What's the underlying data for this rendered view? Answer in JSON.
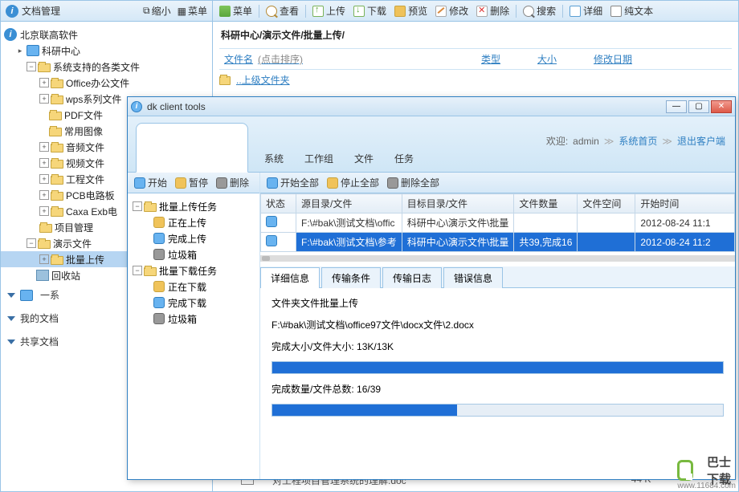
{
  "left": {
    "title": "文档管理",
    "btn_shrink": "缩小",
    "btn_menu": "菜单",
    "root": "北京联高软件",
    "nodes": {
      "n1": "科研中心",
      "n2": "系统支持的各类文件",
      "n3": "Office办公文件",
      "n4": "wps系列文件",
      "n5": "PDF文件",
      "n6": "常用图像",
      "n7": "音频文件",
      "n8": "视频文件",
      "n9": "工程文件",
      "n10": "PCB电路板",
      "n11": "Caxa Exb电",
      "n12": "项目管理",
      "n13": "演示文件",
      "n14": "批量上传",
      "n15": "回收站"
    },
    "sections": {
      "s1": "一系",
      "s2": "我的文档",
      "s3": "共享文档"
    }
  },
  "toolbar": {
    "menu": "菜单",
    "view": "查看",
    "upload": "上传",
    "download": "下载",
    "preview": "预览",
    "edit": "修改",
    "del": "删除",
    "search": "搜索",
    "detail": "详细",
    "plain": "纯文本"
  },
  "breadcrumb": "科研中心/演示文件/批量上传/",
  "filehead": {
    "name": "文件名",
    "hint": "(点击排序)",
    "type": "类型",
    "size": "大小",
    "date": "修改日期"
  },
  "filerow": {
    "up": "..上级文件夹"
  },
  "dialog": {
    "title": "dk client tools",
    "tabs": {
      "system": "系统",
      "group": "工作组",
      "file": "文件",
      "task": "任务"
    },
    "welcome": {
      "label": "欢迎:",
      "user": "admin",
      "home": "系统首页",
      "exit": "退出客户端"
    },
    "ltb": {
      "start": "开始",
      "pause": "暂停",
      "del": "删除"
    },
    "rtb": {
      "startall": "开始全部",
      "stopall": "停止全部",
      "delall": "删除全部"
    },
    "ltree": {
      "up_root": "批量上传任务",
      "up1": "正在上传",
      "up2": "完成上传",
      "up3": "垃圾箱",
      "dn_root": "批量下载任务",
      "dn1": "正在下载",
      "dn2": "完成下载",
      "dn3": "垃圾箱"
    },
    "th": {
      "status": "状态",
      "src": "源目录/文件",
      "dst": "目标目录/文件",
      "count": "文件数量",
      "space": "文件空间",
      "time": "开始时间"
    },
    "rows": [
      {
        "src": "F:\\#bak\\测试文档\\offic",
        "dst": "科研中心\\演示文件\\批量",
        "count": "",
        "space": "",
        "time": "2012-08-24 11:1"
      },
      {
        "src": "F:\\#bak\\测试文档\\参考",
        "dst": "科研中心\\演示文件\\批量",
        "count": "共39,完成16",
        "space": "",
        "time": "2012-08-24 11:2"
      }
    ],
    "subtabs": {
      "t1": "详细信息",
      "t2": "传输条件",
      "t3": "传输日志",
      "t4": "错误信息"
    },
    "detail": {
      "line1": "文件夹文件批量上传",
      "line2": "F:\\#bak\\测试文档\\office97文件\\docx文件\\2.docx",
      "size_label": "完成大小/文件大小:",
      "size_val": "13K/13K",
      "count_label": "完成数量/文件总数:",
      "count_val": "16/39",
      "prog1_pct": 100,
      "prog2_pct": 41
    }
  },
  "footer": {
    "row_label": "对工程项目管理系统的理解.doc",
    "row_size": "44 K"
  },
  "brand": {
    "name": "巴士下载",
    "url": "www.11684.com"
  }
}
